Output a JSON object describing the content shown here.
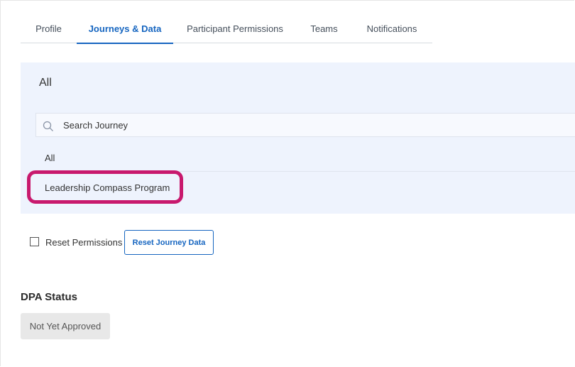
{
  "tabs": [
    {
      "label": "Profile"
    },
    {
      "label": "Journeys & Data"
    },
    {
      "label": "Participant Permissions"
    },
    {
      "label": "Teams"
    },
    {
      "label": "Notifications"
    }
  ],
  "active_tab": "Journeys & Data",
  "journey_panel": {
    "selected": "All",
    "search_placeholder": "Search Journey",
    "options": [
      {
        "label": "All"
      },
      {
        "label": "Leadership Compass Program"
      }
    ]
  },
  "actions": {
    "reset_permissions_label": "Reset Permissions",
    "reset_permissions_checked": false,
    "reset_journey_data_label": "Reset Journey Data"
  },
  "dpa": {
    "heading": "DPA Status",
    "status": "Not Yet Approved"
  },
  "colors": {
    "accent": "#1565c0",
    "highlight": "#c8196d",
    "panel_bg": "#eef3fd"
  }
}
